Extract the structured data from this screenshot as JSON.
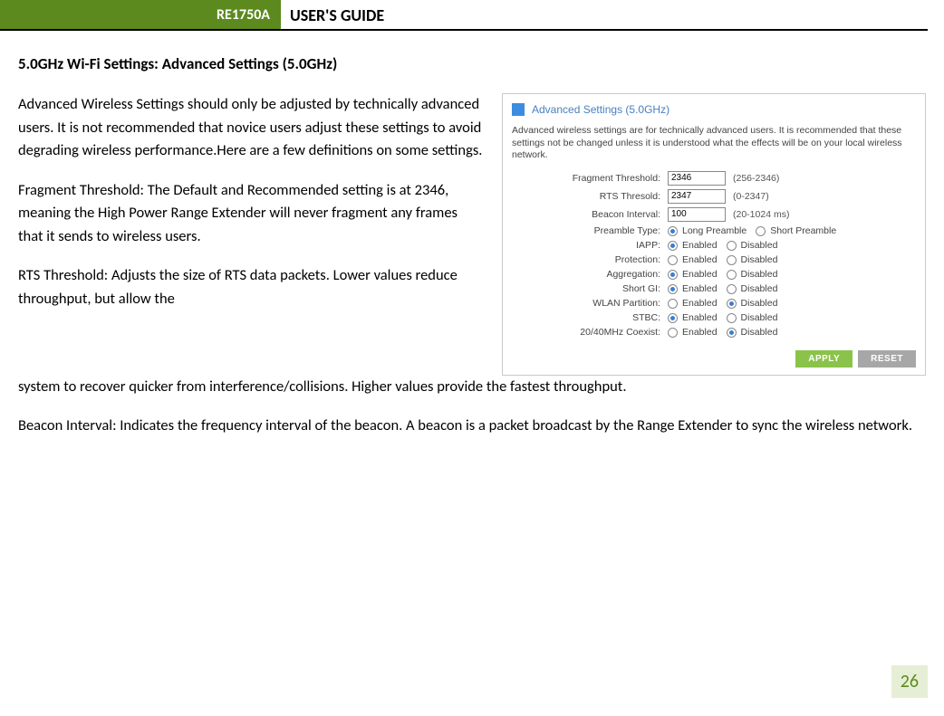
{
  "header": {
    "badge": "RE1750A",
    "title": "USER'S GUIDE"
  },
  "sectionTitle": "5.0GHz Wi-Fi Settings: Advanced Settings (5.0GHz)",
  "paragraphs": {
    "p1": "Advanced Wireless Settings should only be adjusted by technically advanced users. It is not recommended that novice users adjust these settings to avoid degrading wireless performance.Here are a few definitions on some settings.",
    "p2": "Fragment Threshold: The Default and Recommended setting is at 2346, meaning the High Power Range Extender will never fragment any frames that it sends to wireless users.",
    "p3a": "RTS Threshold: Adjusts the size of RTS data packets. Lower values reduce throughput, but allow the",
    "p3b": "system to recover quicker from interference/collisions. Higher values provide the fastest throughput.",
    "p4": "Beacon Interval: Indicates the frequency interval of the beacon. A beacon is a packet broadcast by the Range Extender to sync the wireless network."
  },
  "panel": {
    "title": "Advanced Settings (5.0GHz)",
    "note": "Advanced wireless settings are for technically advanced users. It is recommended that these settings not be changed unless it is understood what the effects will be on your local wireless network.",
    "fields": {
      "fragThreshold": {
        "label": "Fragment Threshold:",
        "value": "2346",
        "range": "(256-2346)"
      },
      "rtsThresold": {
        "label": "RTS Thresold:",
        "value": "2347",
        "range": "(0-2347)"
      },
      "beaconInterval": {
        "label": "Beacon Interval:",
        "value": "100",
        "range": "(20-1024 ms)"
      }
    },
    "radios": {
      "preamble": {
        "label": "Preamble Type:",
        "opt1": "Long Preamble",
        "opt2": "Short Preamble",
        "selected": 1
      },
      "iapp": {
        "label": "IAPP:",
        "opt1": "Enabled",
        "opt2": "Disabled",
        "selected": 1
      },
      "protection": {
        "label": "Protection:",
        "opt1": "Enabled",
        "opt2": "Disabled",
        "selected": 0
      },
      "aggregation": {
        "label": "Aggregation:",
        "opt1": "Enabled",
        "opt2": "Disabled",
        "selected": 1
      },
      "shortGi": {
        "label": "Short GI:",
        "opt1": "Enabled",
        "opt2": "Disabled",
        "selected": 1
      },
      "wlan": {
        "label": "WLAN Partition:",
        "opt1": "Enabled",
        "opt2": "Disabled",
        "selected": 2
      },
      "stbc": {
        "label": "STBC:",
        "opt1": "Enabled",
        "opt2": "Disabled",
        "selected": 1
      },
      "coexist": {
        "label": "20/40MHz Coexist:",
        "opt1": "Enabled",
        "opt2": "Disabled",
        "selected": 2
      }
    },
    "buttons": {
      "apply": "APPLY",
      "reset": "RESET"
    }
  },
  "pageNumber": "26"
}
